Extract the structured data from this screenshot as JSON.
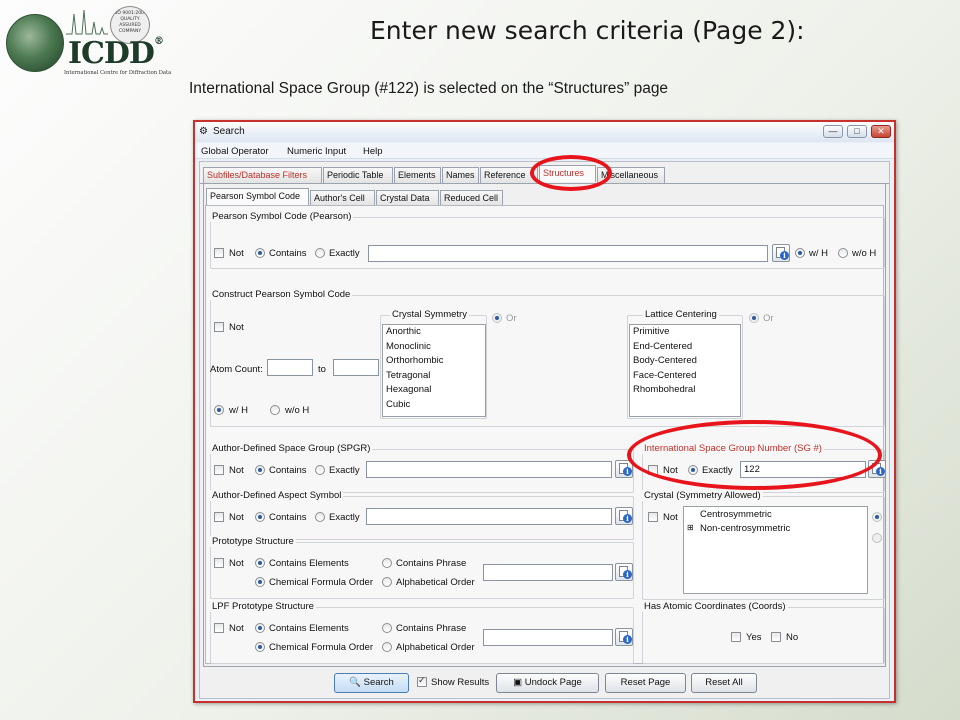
{
  "slide": {
    "title": "Enter new search criteria (Page 2):",
    "subtitle": "International Space Group (#122) is selected on the “Structures” page"
  },
  "logo": {
    "text": "ICDD",
    "registered": "®",
    "tagline": "International Centre for Diffraction Data",
    "seal_text": "ISO 9001:2008 QUALITY ASSURED COMPANY"
  },
  "window": {
    "title": "Search",
    "controls": [
      "—",
      "□",
      "✕"
    ]
  },
  "menu": [
    "Global Operator",
    "Numeric Input",
    "Help"
  ],
  "main_tabs": [
    "Subfiles/Database Filters",
    "Periodic Table",
    "Elements",
    "Names",
    "Reference",
    "Structures",
    "Miscellaneous"
  ],
  "sub_tabs": [
    "Pearson Symbol Code",
    "Author's Cell",
    "Crystal Data",
    "Reduced Cell"
  ],
  "pearson": {
    "title": "Pearson Symbol Code (Pearson)",
    "not": "Not",
    "contains": "Contains",
    "exactly": "Exactly",
    "with_h": "w/ H",
    "without_h": "w/o H"
  },
  "construct": {
    "title": "Construct Pearson Symbol Code",
    "not": "Not",
    "atom_count": "Atom Count:",
    "to": "to",
    "with_h": "w/ H",
    "without_h": "w/o H",
    "crystal_symmetry": {
      "title": "Crystal Symmetry",
      "items": [
        "Anorthic",
        "Monoclinic",
        "Orthorhombic",
        "Tetragonal",
        "Hexagonal",
        "Cubic"
      ],
      "or": "Or"
    },
    "lattice_centering": {
      "title": "Lattice Centering",
      "items": [
        "Primitive",
        "End-Centered",
        "Body-Centered",
        "Face-Centered",
        "Rhombohedral"
      ],
      "or": "Or"
    }
  },
  "spgr": {
    "title": "Author-Defined Space Group (SPGR)",
    "not": "Not",
    "contains": "Contains",
    "exactly": "Exactly"
  },
  "sgnum": {
    "title": "International Space Group Number (SG #)",
    "not": "Not",
    "exactly": "Exactly",
    "value": "122"
  },
  "aspect": {
    "title": "Author-Defined Aspect Symbol",
    "not": "Not",
    "contains": "Contains",
    "exactly": "Exactly"
  },
  "crystal_sym_allowed": {
    "title": "Crystal (Symmetry Allowed)",
    "not": "Not",
    "tree": [
      "Centrosymmetric",
      "Non-centrosymmetric"
    ],
    "tree_expander": "⊞"
  },
  "prototype": {
    "title": "Prototype Structure",
    "not": "Not",
    "contains_elements": "Contains Elements",
    "contains_phrase": "Contains Phrase",
    "chemical_formula_order": "Chemical Formula Order",
    "alphabetical_order": "Alphabetical Order"
  },
  "lpf": {
    "title": "LPF Prototype Structure",
    "not": "Not",
    "contains_elements": "Contains Elements",
    "contains_phrase": "Contains Phrase",
    "chemical_formula_order": "Chemical Formula Order",
    "alphabetical_order": "Alphabetical Order"
  },
  "coords": {
    "title": "Has Atomic Coordinates (Coords)",
    "yes": "Yes",
    "no": "No"
  },
  "bottom": {
    "search": "Search",
    "show_results": "Show Results",
    "undock": "Undock Page",
    "reset_page": "Reset Page",
    "reset_all": "Reset All"
  },
  "colors": {
    "annotation": "#e8141c",
    "highlight_text": "#c0312b",
    "window_border": "#c8302c"
  }
}
